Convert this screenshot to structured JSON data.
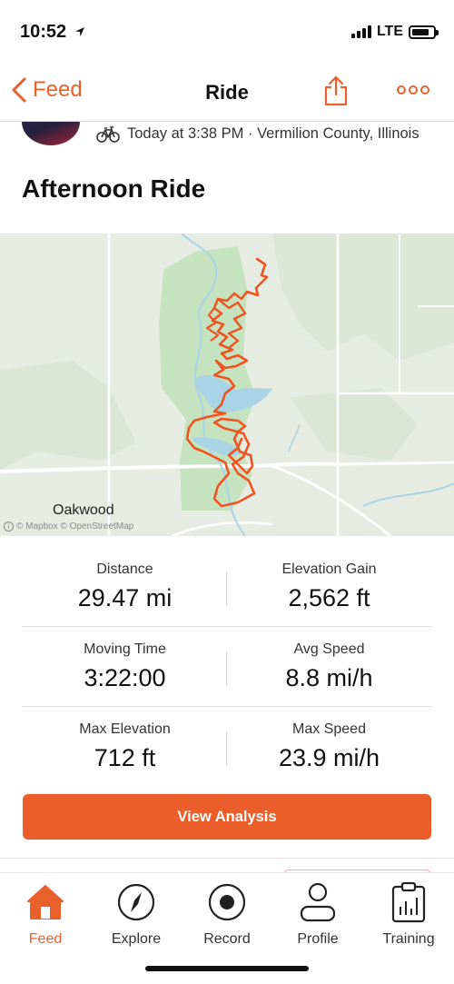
{
  "status_bar": {
    "time": "10:52",
    "network": "LTE"
  },
  "nav": {
    "back_label": "Feed",
    "title": "Ride"
  },
  "activity": {
    "meta": "Today at 3:38 PM · Vermilion County, Illinois",
    "title": "Afternoon Ride"
  },
  "map": {
    "town_label": "Oakwood",
    "credit": "© Mapbox © OpenStreetMap"
  },
  "stats": [
    {
      "label": "Distance",
      "value": "29.47 mi"
    },
    {
      "label": "Elevation Gain",
      "value": "2,562 ft"
    },
    {
      "label": "Moving Time",
      "value": "3:22:00"
    },
    {
      "label": "Avg Speed",
      "value": "8.8 mi/h"
    },
    {
      "label": "Max Elevation",
      "value": "712 ft"
    },
    {
      "label": "Max Speed",
      "value": "23.9 mi/h"
    }
  ],
  "analysis_button": "View Analysis",
  "tabs": [
    {
      "label": "Feed",
      "icon": "home-icon",
      "active": true
    },
    {
      "label": "Explore",
      "icon": "compass-icon",
      "active": false
    },
    {
      "label": "Record",
      "icon": "record-icon",
      "active": false
    },
    {
      "label": "Profile",
      "icon": "profile-icon",
      "active": false
    },
    {
      "label": "Training",
      "icon": "training-icon",
      "active": false
    }
  ],
  "colors": {
    "accent": "#eb5e2b",
    "route": "#f0531f",
    "water": "#a9d4e6",
    "park": "#c5e3bf"
  }
}
